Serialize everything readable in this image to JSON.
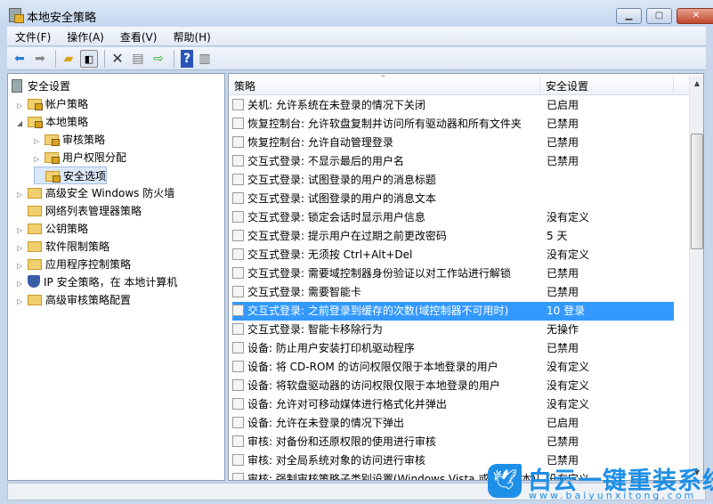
{
  "window": {
    "title": "本地安全策略",
    "min": "▁",
    "max": "▢",
    "close": "✕"
  },
  "menu": [
    "文件(F)",
    "操作(A)",
    "查看(V)",
    "帮助(H)"
  ],
  "toolbar": [
    "back-icon",
    "forward-icon",
    "up-folder-icon",
    "show-hide-tree-icon",
    "delete-icon",
    "properties-icon",
    "export-icon",
    "help-icon",
    "show-action-pane-icon"
  ],
  "tree": [
    {
      "label": "安全设置",
      "level": 0,
      "expand": "",
      "icon": "root"
    },
    {
      "label": "帐户策略",
      "level": 1,
      "expand": "▷",
      "icon": "lock"
    },
    {
      "label": "本地策略",
      "level": 1,
      "expand": "◢",
      "icon": "lock"
    },
    {
      "label": "审核策略",
      "level": 2,
      "expand": "▷",
      "icon": "lock"
    },
    {
      "label": "用户权限分配",
      "level": 2,
      "expand": "▷",
      "icon": "lock"
    },
    {
      "label": "安全选项",
      "level": 2,
      "expand": "",
      "icon": "lock",
      "selected": true
    },
    {
      "label": "高级安全 Windows 防火墙",
      "level": 1,
      "expand": "▷",
      "icon": "folder"
    },
    {
      "label": "网络列表管理器策略",
      "level": 1,
      "expand": "",
      "icon": "folder"
    },
    {
      "label": "公钥策略",
      "level": 1,
      "expand": "▷",
      "icon": "folder"
    },
    {
      "label": "软件限制策略",
      "level": 1,
      "expand": "▷",
      "icon": "folder"
    },
    {
      "label": "应用程序控制策略",
      "level": 1,
      "expand": "▷",
      "icon": "folder"
    },
    {
      "label": "IP 安全策略，在 本地计算机",
      "level": 1,
      "expand": "▷",
      "icon": "shield"
    },
    {
      "label": "高级审核策略配置",
      "level": 1,
      "expand": "▷",
      "icon": "folder"
    }
  ],
  "table": {
    "headers": [
      "策略",
      "安全设置"
    ],
    "sort_indicator": "^",
    "rows": [
      [
        "关机: 允许系统在未登录的情况下关闭",
        "已启用"
      ],
      [
        "恢复控制台: 允许软盘复制并访问所有驱动器和所有文件夹",
        "已禁用"
      ],
      [
        "恢复控制台: 允许自动管理登录",
        "已禁用"
      ],
      [
        "交互式登录: 不显示最后的用户名",
        "已禁用"
      ],
      [
        "交互式登录: 试图登录的用户的消息标题",
        ""
      ],
      [
        "交互式登录: 试图登录的用户的消息文本",
        ""
      ],
      [
        "交互式登录: 锁定会话时显示用户信息",
        "没有定义"
      ],
      [
        "交互式登录: 提示用户在过期之前更改密码",
        "5 天"
      ],
      [
        "交互式登录: 无须按 Ctrl+Alt+Del",
        "没有定义"
      ],
      [
        "交互式登录: 需要域控制器身份验证以对工作站进行解锁",
        "已禁用"
      ],
      [
        "交互式登录: 需要智能卡",
        "已禁用"
      ],
      [
        "交互式登录: 之前登录到缓存的次数(域控制器不可用时)",
        "10 登录"
      ],
      [
        "交互式登录: 智能卡移除行为",
        "无操作"
      ],
      [
        "设备: 防止用户安装打印机驱动程序",
        "已禁用"
      ],
      [
        "设备: 将 CD-ROM 的访问权限仅限于本地登录的用户",
        "没有定义"
      ],
      [
        "设备: 将软盘驱动器的访问权限仅限于本地登录的用户",
        "没有定义"
      ],
      [
        "设备: 允许对可移动媒体进行格式化并弹出",
        "没有定义"
      ],
      [
        "设备: 允许在未登录的情况下弹出",
        "已启用"
      ],
      [
        "审核: 对备份和还原权限的使用进行审核",
        "已禁用"
      ],
      [
        "审核: 对全局系统对象的访问进行审核",
        "已禁用"
      ],
      [
        "审核: 强制审核策略子类别设置(Windows Vista 或更高版本)以替代审核策略类别设置",
        "没有定义"
      ]
    ],
    "selected_index": 11
  },
  "watermark": {
    "brand": "白云一键重装系统",
    "url": "www.baiyunxitong.com"
  },
  "colors": {
    "selection": "#3399ff",
    "watermark": "#1e8fe6"
  }
}
